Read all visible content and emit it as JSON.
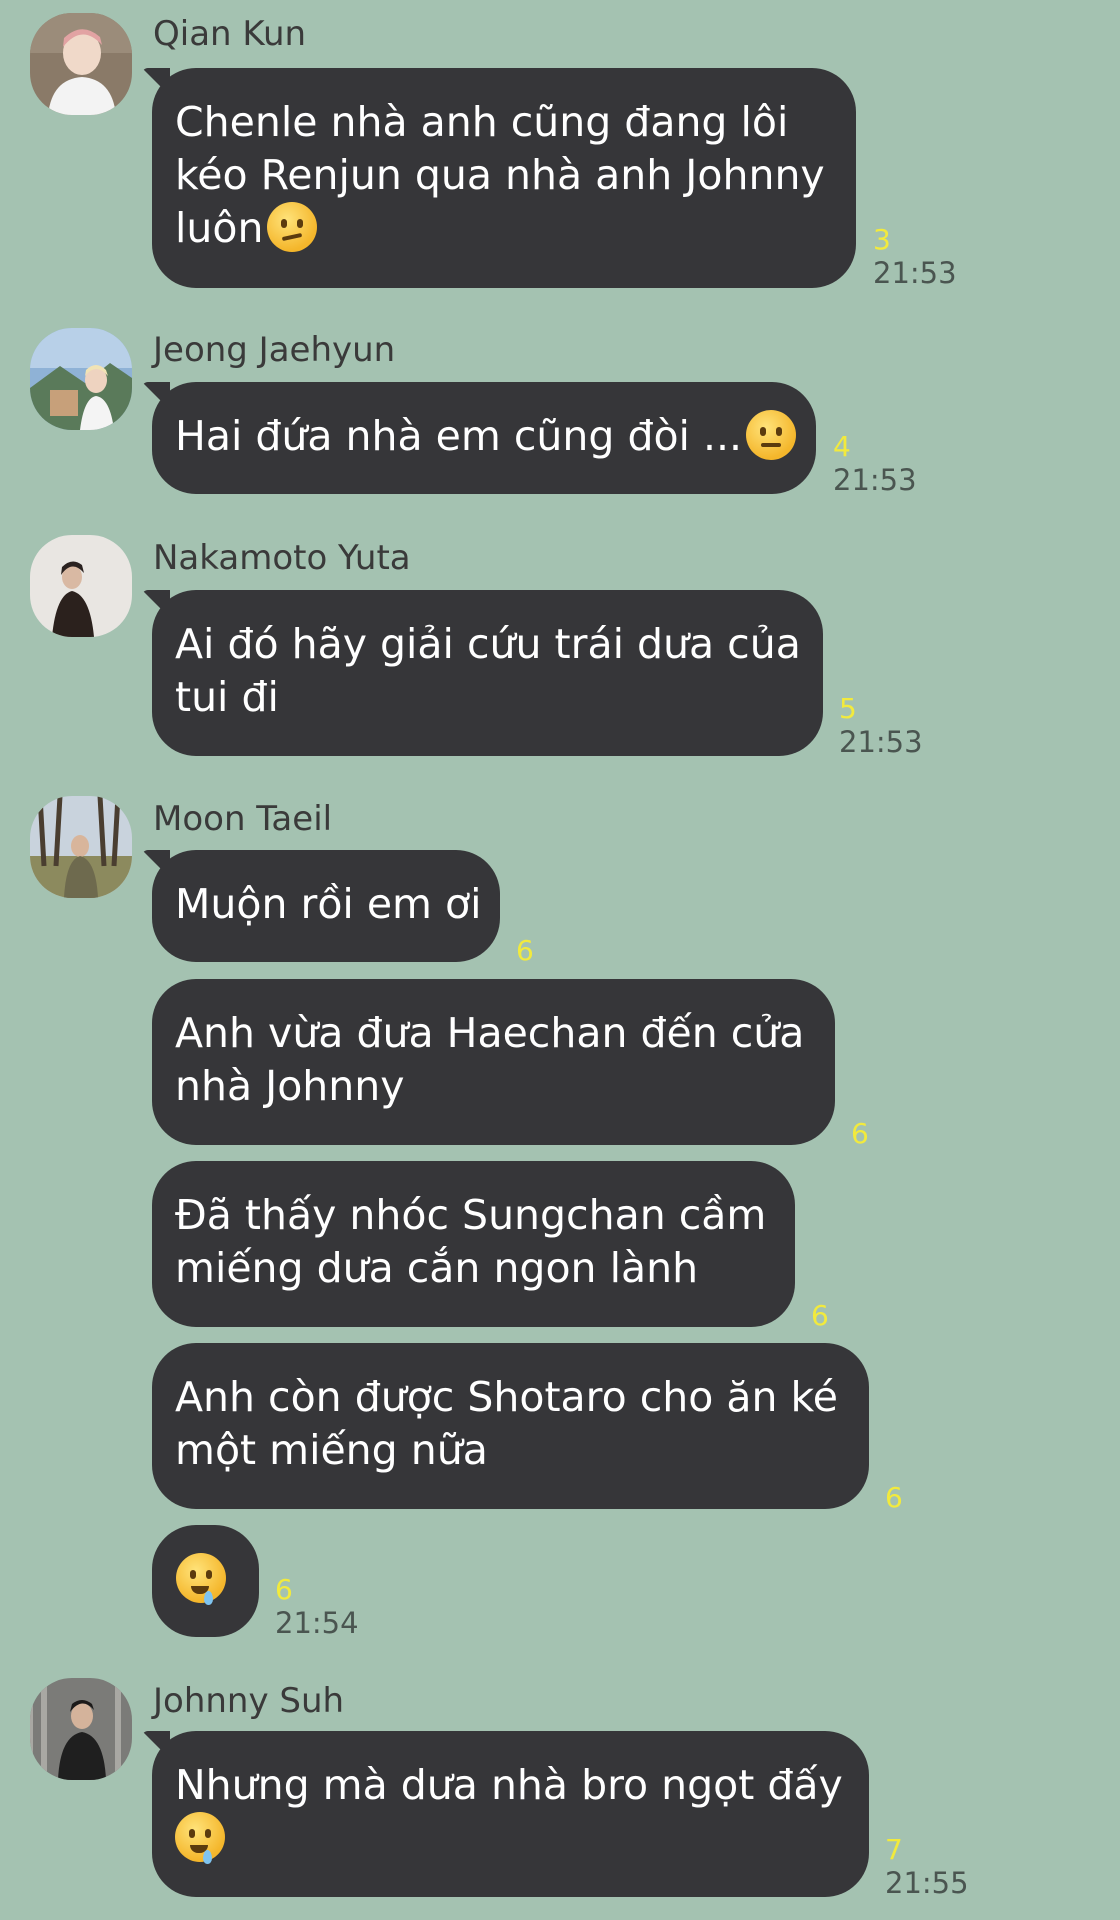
{
  "colors": {
    "background": "#a4c2b1",
    "bubble": "#363639",
    "read_count": "#f2ea3d",
    "time": "#4a5550"
  },
  "messages": [
    {
      "sender": "Qian Kun",
      "bubbles": [
        {
          "lines": [
            "Chenle nhà anh cũng đang lôi",
            "kéo Renjun qua nhà anh Johnny",
            "luôn"
          ],
          "emoji": "confused-face",
          "read": "3",
          "time": "21:53"
        }
      ]
    },
    {
      "sender": "Jeong Jaehyun",
      "bubbles": [
        {
          "lines": [
            "Hai đứa nhà em cũng đòi ..."
          ],
          "emoji": "neutral-face",
          "read": "4",
          "time": "21:53"
        }
      ]
    },
    {
      "sender": "Nakamoto Yuta",
      "bubbles": [
        {
          "lines": [
            "Ai đó hãy giải cứu trái dưa của",
            "tui đi"
          ],
          "read": "5",
          "time": "21:53"
        }
      ]
    },
    {
      "sender": "Moon Taeil",
      "bubbles": [
        {
          "lines": [
            "Muộn rồi em ơi"
          ],
          "read": "6"
        },
        {
          "lines": [
            "Anh vừa đưa Haechan đến cửa",
            "nhà Johnny"
          ],
          "read": "6"
        },
        {
          "lines": [
            "Đã thấy nhóc Sungchan cầm",
            "miếng dưa cắn ngon lành"
          ],
          "read": "6"
        },
        {
          "lines": [
            "Anh còn được Shotaro cho ăn ké",
            "một miếng nữa"
          ],
          "read": "6"
        },
        {
          "lines": [],
          "emoji": "drooling-face",
          "read": "6",
          "time": "21:54"
        }
      ]
    },
    {
      "sender": "Johnny Suh",
      "bubbles": [
        {
          "lines": [
            "Nhưng mà dưa nhà bro ngọt đấy"
          ],
          "emoji": "drooling-face",
          "read": "7",
          "time": "21:55"
        }
      ]
    }
  ]
}
